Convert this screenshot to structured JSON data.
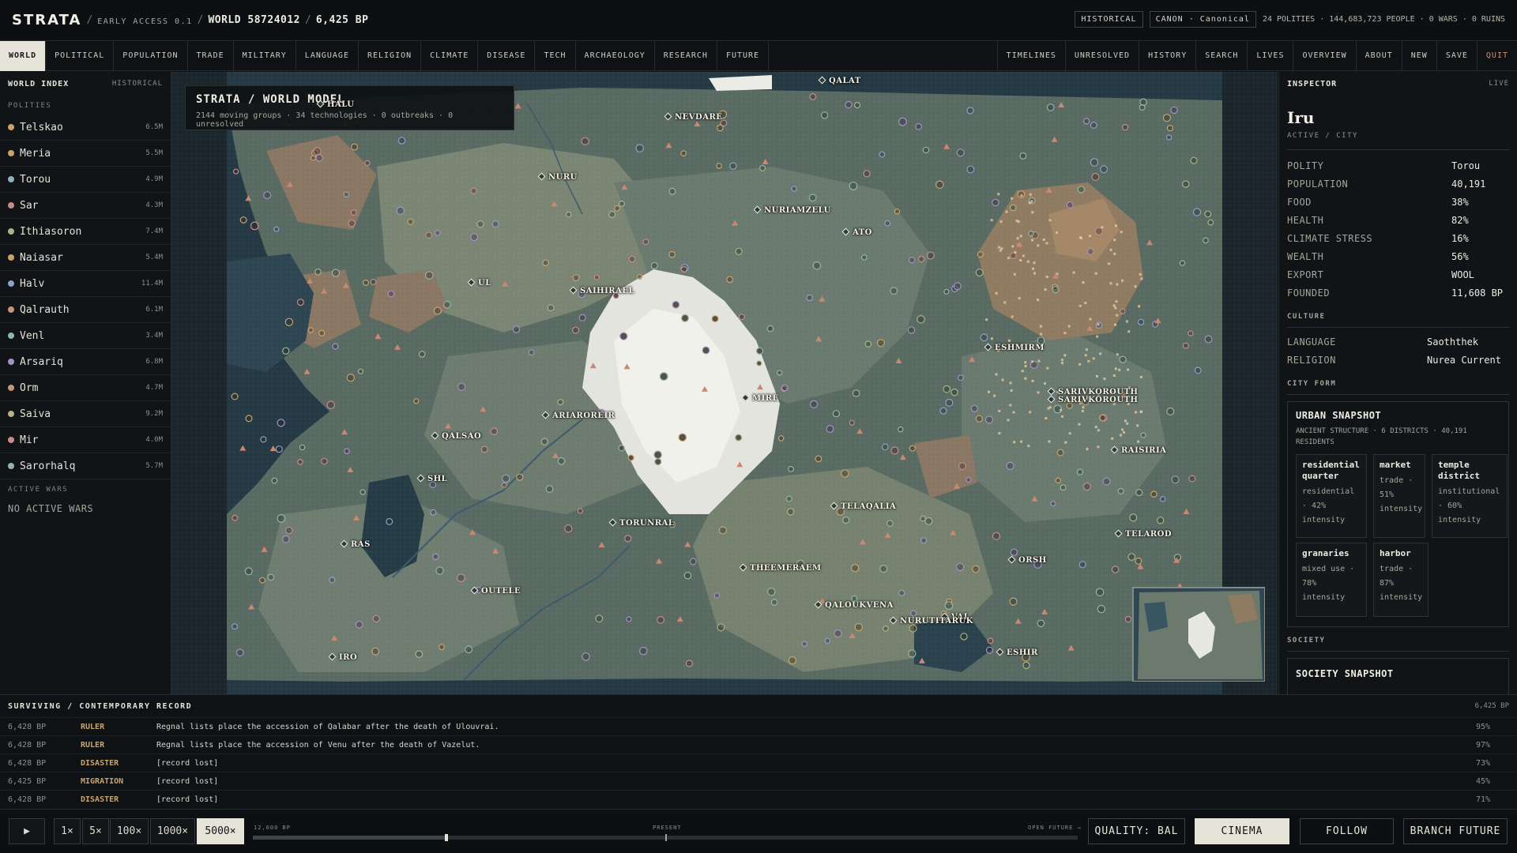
{
  "topbar": {
    "brand": "STRATA",
    "early_access": "EARLY ACCESS 0.1",
    "world": "WORLD 58724012",
    "date": "6,425 BP",
    "mode_chip": "HISTORICAL",
    "canon_chip": "CANON · Canonical",
    "stats": "24 POLITIES · 144,683,723 PEOPLE · 0 WARS · 0 RUINS"
  },
  "nav": {
    "left": [
      "WORLD",
      "POLITICAL",
      "POPULATION",
      "TRADE",
      "MILITARY",
      "LANGUAGE",
      "RELIGION",
      "CLIMATE",
      "DISEASE",
      "TECH",
      "ARCHAEOLOGY",
      "RESEARCH",
      "FUTURE"
    ],
    "right": [
      "TIMELINES",
      "UNRESOLVED",
      "HISTORY",
      "SEARCH",
      "LIVES",
      "OVERVIEW",
      "ABOUT",
      "NEW",
      "SAVE",
      "QUIT"
    ],
    "active": "WORLD"
  },
  "sidebar": {
    "title": "WORLD INDEX",
    "mode": "HISTORICAL",
    "polities_label": "POLITIES",
    "polities": [
      {
        "name": "Telskao",
        "pop": "6.5M",
        "color": "#c9a36a"
      },
      {
        "name": "Meria",
        "pop": "5.5M",
        "color": "#c9a36a"
      },
      {
        "name": "Torou",
        "pop": "4.9M",
        "color": "#8fb0b7"
      },
      {
        "name": "Sar",
        "pop": "4.3M",
        "color": "#c98a8a"
      },
      {
        "name": "Ithiasoron",
        "pop": "7.4M",
        "color": "#a6b48a"
      },
      {
        "name": "Naiasar",
        "pop": "5.4M",
        "color": "#c9a36a"
      },
      {
        "name": "Halv",
        "pop": "11.4M",
        "color": "#8fa0c9"
      },
      {
        "name": "Qalrauth",
        "pop": "6.1M",
        "color": "#c9947a"
      },
      {
        "name": "Venl",
        "pop": "3.4M",
        "color": "#8fb7a6"
      },
      {
        "name": "Arsariq",
        "pop": "6.8M",
        "color": "#a78fc9"
      },
      {
        "name": "Orm",
        "pop": "4.7M",
        "color": "#c9947a"
      },
      {
        "name": "Saiva",
        "pop": "9.2M",
        "color": "#b7b08f"
      },
      {
        "name": "Mir",
        "pop": "4.0M",
        "color": "#c98a8a"
      },
      {
        "name": "Sarorhalq",
        "pop": "5.7M",
        "color": "#8fb7a6"
      }
    ],
    "wars_label": "ACTIVE WARS",
    "wars_empty": "NO ACTIVE WARS"
  },
  "map": {
    "title": "STRATA / WORLD MODEL",
    "subtitle": "2144 moving groups · 34 technologies · 0 outbreaks · 0 unresolved",
    "cities": [
      "QALAT",
      "HALU",
      "NEVDARE",
      "NURU",
      "NURIAMZELU",
      "ATO",
      "UL",
      "SAIHIRAEL",
      "ESHMIRM",
      "SARIVKOROUTH",
      "SARIVKOROUTH",
      "MIRE",
      "ARIAROREIR",
      "QALSAO",
      "RAISIRIA",
      "SHL",
      "TELAQALIA",
      "TORUNRAL",
      "TELAROD",
      "RAS",
      "ORSH",
      "THEEMERAEM",
      "OUTELE",
      "QALOUKVENA",
      "VAI",
      "NURUTITARUK",
      "IRO",
      "ESHIR"
    ]
  },
  "inspector": {
    "title": "INSPECTOR",
    "status": "LIVE",
    "name": "Iru",
    "type": "ACTIVE / CITY",
    "stats": [
      {
        "k": "POLITY",
        "v": "Torou"
      },
      {
        "k": "POPULATION",
        "v": "40,191"
      },
      {
        "k": "FOOD",
        "v": "38%"
      },
      {
        "k": "HEALTH",
        "v": "82%"
      },
      {
        "k": "CLIMATE STRESS",
        "v": "16%"
      },
      {
        "k": "WEALTH",
        "v": "56%"
      },
      {
        "k": "EXPORT",
        "v": "WOOL"
      },
      {
        "k": "FOUNDED",
        "v": "11,608 BP"
      }
    ],
    "culture_label": "CULTURE",
    "culture": [
      {
        "k": "LANGUAGE",
        "v": "Saoththek"
      },
      {
        "k": "RELIGION",
        "v": "Nurea Current"
      }
    ],
    "cityform_label": "CITY FORM",
    "urban": {
      "title": "URBAN SNAPSHOT",
      "subtitle": "ANCIENT STRUCTURE · 6 DISTRICTS · 40,191 RESIDENTS",
      "districts": [
        {
          "name": "residential quarter",
          "desc": "residential · 42% intensity"
        },
        {
          "name": "market",
          "desc": "trade · 51% intensity"
        },
        {
          "name": "temple district",
          "desc": "institutional · 60% intensity"
        },
        {
          "name": "granaries",
          "desc": "mixed use · 78% intensity"
        },
        {
          "name": "harbor",
          "desc": "trade · 87% intensity"
        }
      ]
    },
    "society_label": "SOCIETY",
    "society_title": "SOCIETY SNAPSHOT"
  },
  "record": {
    "title": "SURVIVING / CONTEMPORARY RECORD",
    "date": "6,425 BP",
    "rows": [
      {
        "date": "6,428 BP",
        "kind": "RULER",
        "text": "Regnal lists place the accession of Qalabar after the death of Ulouvrai.",
        "conf": "95%"
      },
      {
        "date": "6,428 BP",
        "kind": "RULER",
        "text": "Regnal lists place the accession of Venu after the death of Vazelut.",
        "conf": "97%"
      },
      {
        "date": "6,428 BP",
        "kind": "DISASTER",
        "text": "[record lost]",
        "conf": "73%"
      },
      {
        "date": "6,425 BP",
        "kind": "MIGRATION",
        "text": "[record lost]",
        "conf": "45%"
      },
      {
        "date": "6,428 BP",
        "kind": "DISASTER",
        "text": "[record lost]",
        "conf": "71%"
      }
    ]
  },
  "playback": {
    "play_icon": "play-icon",
    "speeds": [
      "1×",
      "5×",
      "100×",
      "1000×",
      "5000×"
    ],
    "active_speed": "5000×",
    "timeline_start": "12,000 BP",
    "timeline_present": "PRESENT",
    "timeline_end": "OPEN FUTURE →",
    "position": 0.235,
    "quality": "QUALITY: BAL",
    "cinema": "CINEMA",
    "follow": "FOLLOW",
    "branch": "BRANCH FUTURE"
  }
}
